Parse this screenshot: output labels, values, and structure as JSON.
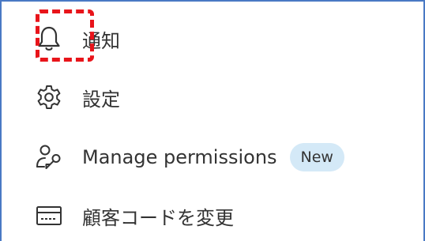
{
  "menu": {
    "items": [
      {
        "key": "notify",
        "label": "通知",
        "icon": "bell-icon"
      },
      {
        "key": "settings",
        "label": "設定",
        "icon": "gear-icon"
      },
      {
        "key": "permissions",
        "label": "Manage permissions",
        "icon": "user-key-icon",
        "badge": "New"
      },
      {
        "key": "customer_code",
        "label": "顧客コードを変更",
        "icon": "card-icon"
      }
    ]
  },
  "highlight": {
    "color": "#e8141a",
    "target": "bell-icon"
  },
  "colors": {
    "frame_border": "#4a79c4",
    "badge_bg": "#d4e9f7",
    "text": "#333333"
  }
}
